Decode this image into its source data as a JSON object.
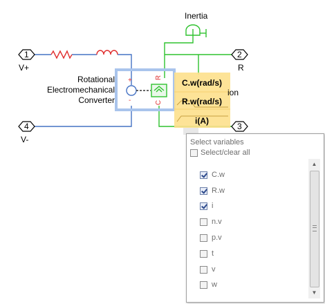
{
  "diagram": {
    "ports": [
      {
        "num": "1",
        "label": "V+"
      },
      {
        "num": "2",
        "label": "R"
      },
      {
        "num": "3",
        "label": ""
      },
      {
        "num": "4",
        "label": "V-"
      }
    ],
    "converter_label_lines": [
      "Rotational",
      "Electromechanical",
      "Converter"
    ],
    "inertia_label": "Inertia",
    "partial_label": "ion",
    "converter_marks": {
      "plus": "+",
      "minus": "-",
      "r": "R",
      "c": "C"
    },
    "probe_labels": [
      "C.w(rad/s)",
      "R.w(rad/s)",
      "i(A)"
    ],
    "colors": {
      "electrical": "#4472c4",
      "mechanical": "#2ec22e",
      "highlight": "#fde08c",
      "selection": "#a9c4ec"
    }
  },
  "variables_menu": {
    "title": "Select variables",
    "select_all_label": "Select/clear all",
    "select_all_checked": false,
    "items": [
      {
        "label": "C.w",
        "checked": true
      },
      {
        "label": "R.w",
        "checked": true
      },
      {
        "label": "i",
        "checked": true
      },
      {
        "label": "n.v",
        "checked": false
      },
      {
        "label": "p.v",
        "checked": false
      },
      {
        "label": "t",
        "checked": false
      },
      {
        "label": "v",
        "checked": false
      },
      {
        "label": "w",
        "checked": false
      }
    ]
  }
}
